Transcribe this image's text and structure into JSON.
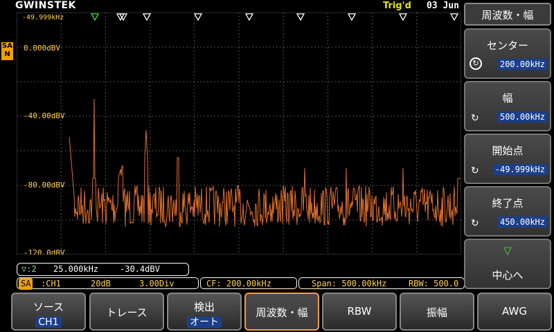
{
  "header": {
    "logo": "GWINSTEK",
    "trigger_status": "Trig'd",
    "date": "03 Jun"
  },
  "channel_badge": "SA N",
  "graph": {
    "start_freq_label": "-49.999kHz",
    "y_labels": [
      "0.000dBV",
      "-40.00dBV",
      "-80.00dBV",
      "-120.0dBV"
    ],
    "trace_color": "#e0702a",
    "grid_color": "#555555"
  },
  "marker": {
    "id": "▽:2",
    "freq": "25.000kHz",
    "level": "-30.4dBV"
  },
  "status": {
    "source_badge": "SA",
    "channel": ":CH1",
    "gain": "20dB",
    "div": "3.00Div",
    "cf": "CF: 200.00kHz",
    "span": "Span: 500.00kHz",
    "rbw": "RBW: 500.0"
  },
  "menu": {
    "title": "周波数・幅",
    "buttons": [
      {
        "label": "センター",
        "value": "200.00kHz"
      },
      {
        "label": "幅",
        "value": "500.00kHz"
      },
      {
        "label": "開始点",
        "value": "-49.999kHz"
      },
      {
        "label": "終了点",
        "value": "450.00kHz"
      },
      {
        "label": "中心へ",
        "value": ""
      }
    ]
  },
  "tabs": [
    {
      "label": "ソース",
      "value": "CH1"
    },
    {
      "label": "トレース",
      "value": ""
    },
    {
      "label": "検出",
      "value": "オート"
    },
    {
      "label": "周波数・幅",
      "value": ""
    },
    {
      "label": "RBW",
      "value": ""
    },
    {
      "label": "振幅",
      "value": ""
    },
    {
      "label": "AWG",
      "value": ""
    }
  ]
}
